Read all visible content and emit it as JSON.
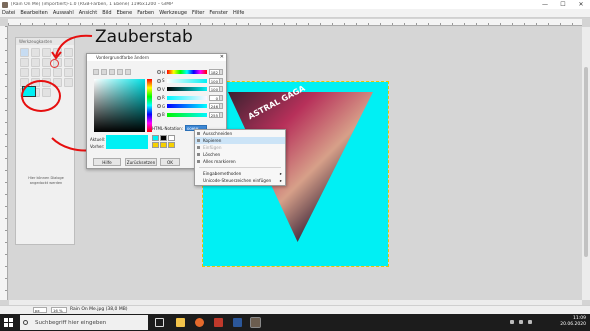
{
  "window": {
    "title": "[Rain On Me] (importiert)-1.0 (RGB-Farben, 1 Ebene) 1196x1200 – GIMP",
    "minimize": "—",
    "maximize": "☐",
    "close": "✕"
  },
  "menubar": [
    "Datei",
    "Bearbeiten",
    "Auswahl",
    "Ansicht",
    "Bild",
    "Ebene",
    "Farben",
    "Werkzeuge",
    "Filter",
    "Fenster",
    "Hilfe"
  ],
  "toolbox": {
    "title": "Werkzeugkasten",
    "hint": "Hier können Dialoge angedockt werden",
    "fg_color": "#00f0f4",
    "bg_color": "#ffffff"
  },
  "annotation": {
    "label": "Zauberstab",
    "color": "#e60f0f"
  },
  "image": {
    "background": "#00f0f4",
    "photo_text": "ASTRAL GAGA"
  },
  "color_dialog": {
    "title": "Vordergrundfarbe ändern",
    "close": "✕",
    "channels": [
      {
        "label": "H",
        "value": "182"
      },
      {
        "label": "S",
        "value": "100"
      },
      {
        "label": "V",
        "value": "100"
      },
      {
        "label": "R",
        "value": "0"
      },
      {
        "label": "G",
        "value": "246"
      },
      {
        "label": "B",
        "value": "255"
      }
    ],
    "html_label": "HTML-Notation:",
    "html_value": "00f6ff",
    "current_label": "Aktuell:",
    "previous_label": "Vorher:",
    "buttons": {
      "help": "Hilfe",
      "reset": "Zurücksetzen",
      "ok": "OK"
    }
  },
  "context_menu": {
    "items": [
      {
        "label": "Ausschneiden",
        "state": "normal"
      },
      {
        "label": "Kopieren",
        "state": "highlighted"
      },
      {
        "label": "Einfügen",
        "state": "disabled"
      },
      {
        "label": "Löschen",
        "state": "normal"
      },
      {
        "label": "Alles markieren",
        "state": "normal"
      }
    ],
    "extra": [
      {
        "label": "Eingabemethoden",
        "submenu": "▸"
      },
      {
        "label": "Unicode-Steuerzeichen einfügen",
        "submenu": "▸"
      }
    ]
  },
  "statusbar": {
    "unit": "px",
    "zoom": "16 %",
    "file": "Rain On Me.jpg (38,0 MB)"
  },
  "taskbar": {
    "search_placeholder": "Suchbegriff hier eingeben",
    "time": "11:09",
    "date": "20.06.2020"
  }
}
